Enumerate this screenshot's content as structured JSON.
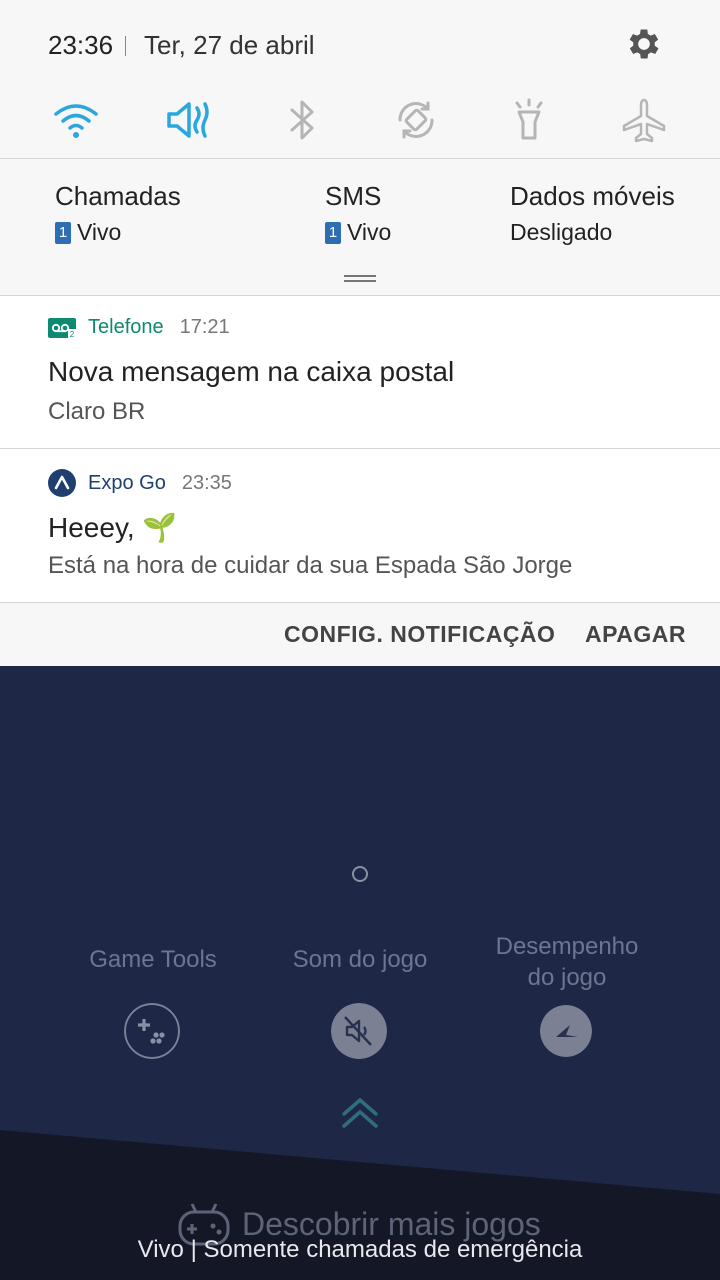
{
  "status": {
    "time": "23:36",
    "date": "Ter, 27 de abril"
  },
  "quick_settings": [
    {
      "icon": "wifi-icon",
      "active": true
    },
    {
      "icon": "mute-icon",
      "active": true
    },
    {
      "icon": "bluetooth-icon",
      "active": false
    },
    {
      "icon": "auto-rotate-icon",
      "active": false
    },
    {
      "icon": "flashlight-icon",
      "active": false
    },
    {
      "icon": "airplane-mode-icon",
      "active": false
    }
  ],
  "sim": {
    "calls_title": "Chamadas",
    "calls_sim": "1",
    "calls_value": "Vivo",
    "sms_title": "SMS",
    "sms_sim": "1",
    "sms_value": "Vivo",
    "data_title": "Dados móveis",
    "data_value": "Desligado"
  },
  "notifications": [
    {
      "app": "Telefone",
      "time": "17:21",
      "title": "Nova mensagem na caixa postal",
      "body": "Claro BR"
    },
    {
      "app": "Expo Go",
      "time": "23:35",
      "title": "Heeey, 🌱",
      "body": "Está na hora de cuidar da sua Espada São Jorge"
    }
  ],
  "actions": {
    "settings": "CONFIG. NOTIFICAÇÃO",
    "clear": "APAGAR"
  },
  "game": {
    "tools": "Game Tools",
    "sound": "Som do jogo",
    "performance_line1": "Desempenho",
    "performance_line2": "do jogo",
    "discover": "Descobrir mais jogos"
  },
  "carrier_text": "Vivo | Somente chamadas de emergência",
  "colors": {
    "accent": "#2aa7e0",
    "telefone": "#0d8a6f",
    "expo": "#1f3f6e",
    "background": "#1f2746"
  }
}
